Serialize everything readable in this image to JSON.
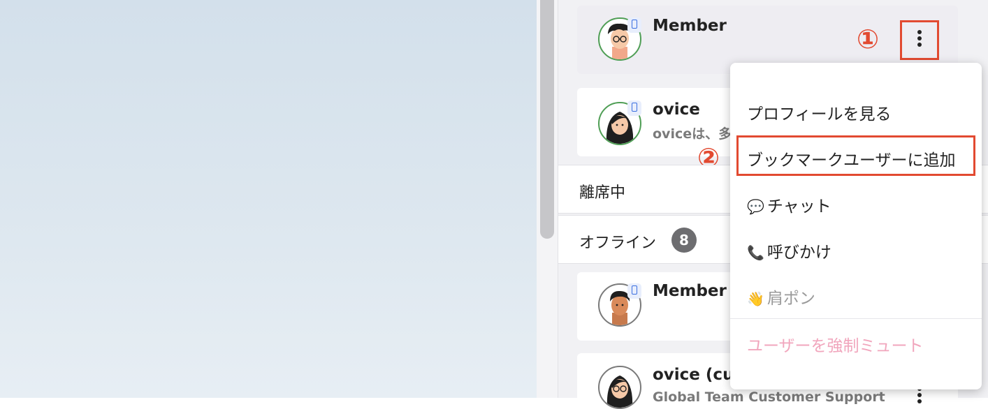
{
  "members": [
    {
      "name": "Member",
      "status": "online",
      "device": "mobile"
    },
    {
      "name": "ovice",
      "subtitle": "oviceは、多",
      "status": "online",
      "device": "mobile"
    }
  ],
  "sections": {
    "away": {
      "label": "離席中"
    },
    "offline": {
      "label": "オフライン",
      "count": "8"
    }
  },
  "offline_members": [
    {
      "name": "Member",
      "status": "offline",
      "device": "mobile"
    },
    {
      "name": "ovice (cus",
      "subtitle": "Global Team Customer Support",
      "status": "offline"
    }
  ],
  "context_menu": {
    "items": [
      {
        "label": "プロフィールを見る",
        "icon": ""
      },
      {
        "label": "ブックマークユーザーに追加",
        "icon": ""
      },
      {
        "label": "チャット",
        "icon": "speech-bubble-icon",
        "glyph": "💬"
      },
      {
        "label": "呼びかけ",
        "icon": "telephone-icon",
        "glyph": "📞"
      },
      {
        "label": "肩ポン",
        "icon": "waving-hand-icon",
        "glyph": "👋",
        "state": "disabled"
      },
      {
        "label": "ユーザーを強制ミュート",
        "icon": "",
        "style": "danger"
      }
    ]
  },
  "annotations": {
    "step1": "①",
    "step2": "②"
  },
  "colors": {
    "annotation": "#e24a31",
    "online_ring": "#4f9e55",
    "offline_ring": "#7a7a7a",
    "danger_text": "#f1a6bd",
    "device_badge": "#3b6fe0"
  }
}
